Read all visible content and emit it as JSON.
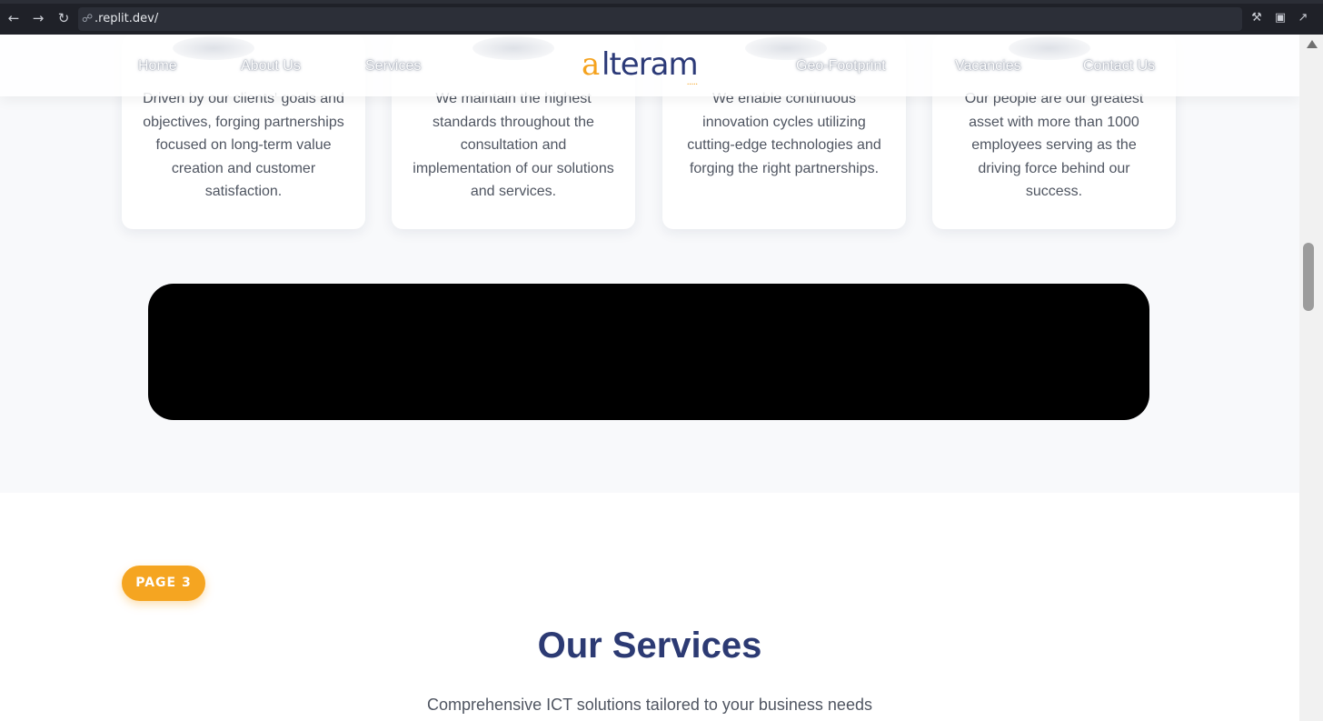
{
  "browser": {
    "url": ".replit.dev/",
    "icons": [
      "back-icon",
      "forward-icon",
      "reload-icon",
      "link-icon",
      "wrench-icon",
      "devices-icon",
      "open-external-icon"
    ]
  },
  "header": {
    "logo_text": "alteram",
    "nav_left": [
      "Home",
      "About Us",
      "Services"
    ],
    "nav_right": [
      "Geo-Footprint",
      "Vacancies",
      "Contact Us"
    ]
  },
  "values": {
    "cards": [
      {
        "text": "Driven by our clients' goals and objectives, forging partnerships focused on long-term value creation and customer satisfaction."
      },
      {
        "text": "We maintain the highest standards throughout the consultation and implementation of our solutions and services."
      },
      {
        "text": "We enable continuous innovation cycles utilizing cutting-edge technologies and forging the right partnerships."
      },
      {
        "text": "Our people are our greatest asset with more than 1000 employees serving as the driving force behind our success."
      }
    ]
  },
  "services": {
    "badge": "PAGE 3",
    "title": "Our Services",
    "subtitle": "Comprehensive ICT solutions tailored to your business needs"
  },
  "colors": {
    "brand_orange": "#f5a521",
    "brand_navy": "#2c3a73",
    "section_bg": "#f8f9fb"
  }
}
